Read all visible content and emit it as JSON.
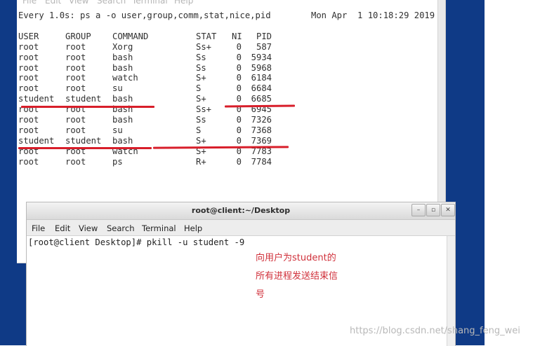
{
  "back_terminal": {
    "menu": [
      "File",
      "Edit",
      "View",
      "Search",
      "Terminal",
      "Help"
    ],
    "header": "Every 1.0s: ps a -o user,group,comm,stat,nice,pid",
    "timestamp": "Mon Apr  1 10:18:29 2019",
    "columns": [
      "USER",
      "GROUP",
      "COMMAND",
      "STAT",
      "NI",
      "PID"
    ],
    "rows": [
      [
        "root",
        "root",
        "Xorg",
        "Ss+",
        "0",
        "587"
      ],
      [
        "root",
        "root",
        "bash",
        "Ss",
        "0",
        "5934"
      ],
      [
        "root",
        "root",
        "bash",
        "Ss",
        "0",
        "5968"
      ],
      [
        "root",
        "root",
        "watch",
        "S+",
        "0",
        "6184"
      ],
      [
        "root",
        "root",
        "su",
        "S",
        "0",
        "6684"
      ],
      [
        "student",
        "student",
        "bash",
        "S+",
        "0",
        "6685"
      ],
      [
        "root",
        "root",
        "bash",
        "Ss+",
        "0",
        "6945"
      ],
      [
        "root",
        "root",
        "bash",
        "Ss",
        "0",
        "7326"
      ],
      [
        "root",
        "root",
        "su",
        "S",
        "0",
        "7368"
      ],
      [
        "student",
        "student",
        "bash",
        "S+",
        "0",
        "7369"
      ],
      [
        "root",
        "root",
        "watch",
        "S+",
        "0",
        "7783"
      ],
      [
        "root",
        "root",
        "ps",
        "R+",
        "0",
        "7784"
      ]
    ]
  },
  "front_terminal": {
    "title": "root@client:~/Desktop",
    "menu": [
      "File",
      "Edit",
      "View",
      "Search",
      "Terminal",
      "Help"
    ],
    "prompt": "[root@client Desktop]# pkill -u student -9",
    "window_buttons": [
      "minimize",
      "maximize",
      "close"
    ]
  },
  "annotation": {
    "lines": [
      "向用户为student的",
      "所有进程发送结束信",
      "号"
    ],
    "color": "#d0303a"
  },
  "watermark": "https://blog.csdn.net/shang_feng_wei"
}
